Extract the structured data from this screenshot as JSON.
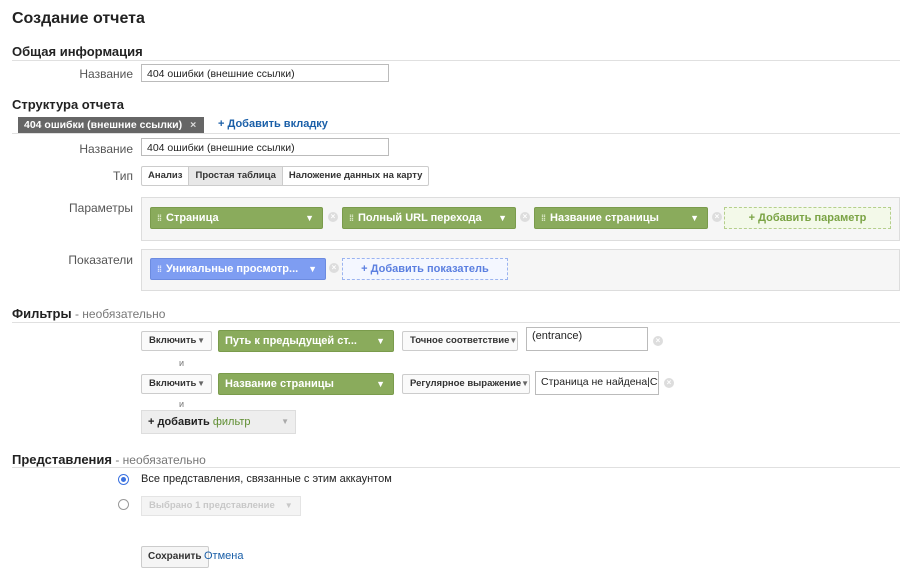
{
  "page_title": "Создание отчета",
  "general": {
    "heading": "Общая информация",
    "name_label": "Название",
    "name_value": "404 ошибки (внешние ссылки)"
  },
  "structure": {
    "heading": "Структура отчета",
    "tab_label": "404 ошибки (внешние ссылки)",
    "tab_close": "×",
    "add_tab": "+ Добавить вкладку",
    "name_label": "Название",
    "name_value": "404 ошибки (внешние ссылки)",
    "type_label": "Тип",
    "types": [
      "Анализ",
      "Простая таблица",
      "Наложение данных на карту"
    ],
    "selected_type": "Простая таблица",
    "params_label": "Параметры",
    "params": [
      "Страница",
      "Полный URL перехода",
      "Название страницы"
    ],
    "add_param": "+ Добавить параметр",
    "metrics_label": "Показатели",
    "metrics": [
      "Уникальные просмотр..."
    ],
    "add_metric": "+ Добавить показатель"
  },
  "filters": {
    "heading": "Фильтры",
    "optional": " - необязательно",
    "rows": [
      {
        "mode": "Включить",
        "dimension": "Путь к предыдущей ст...",
        "match": "Точное соответствие",
        "value": "(entrance)"
      },
      {
        "mode": "Включить",
        "dimension": "Название страницы",
        "match": "Регулярное выражение",
        "value": "Страница не найдена|Стр"
      }
    ],
    "and_label": "и",
    "add_filter_prefix": "+ добавить ",
    "add_filter_word": "фильтр"
  },
  "views": {
    "heading": "Представления",
    "optional": " - необязательно",
    "option_all": "Все представления, связанные с этим аккаунтом",
    "option_selected": "Выбрано 1 представление"
  },
  "actions": {
    "save": "Сохранить",
    "cancel": "Отмена"
  },
  "colors": {
    "dimension_chip": "#8aab5c",
    "metric_chip": "#7e9df2",
    "link": "#1a5fa8"
  }
}
